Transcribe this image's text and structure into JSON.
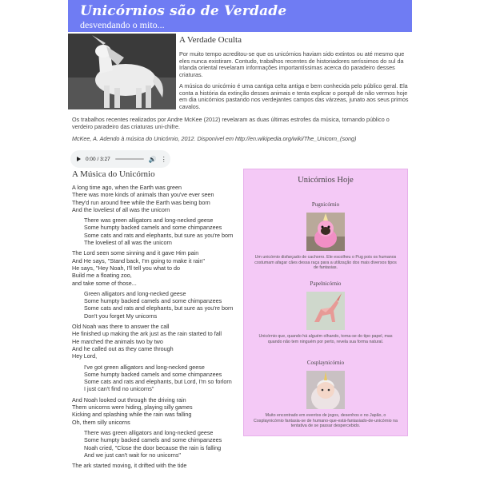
{
  "header": {
    "title": "Unicórnios são de Verdade",
    "subtitle": "desvendando o mito..."
  },
  "intro": {
    "heading": "A Verdade Oculta",
    "p1": "Por muito tempo acreditou-se que os unicórnios haviam sido extintos ou até mesmo que eles nunca existiram. Contudo, trabalhos recentes de historiadores seríssimos do sul da Irlanda oriental revelaram informações importantíssimas acerca do paradeiro desses criaturas.",
    "p2": "A música do unicórnio é uma cantiga celta antiga e bem conhecida pelo público geral. Ela conta a história da extinção desses animais e tenta explicar o porquê de não vermos hoje em dia unicórnios pastando nos verdejantes campos das várzeas, junato aos seus primos cavalos.",
    "p3": "Os trabalhos recentes realizados por Andre McKee (2012) revelaram as duas últimas estrofes da música, tornando público o verdeiro paradeiro das criaturas uni-chifre.",
    "reference": "McKee, A. Adendo à música do Unicórnio, 2012. Disponível em http://en.wikipedia.org/wiki/The_Unicorn_(song)"
  },
  "audio": {
    "time": "0:00 / 3:27"
  },
  "music": {
    "heading": "A Música do Unicórnio",
    "stanzas": [
      {
        "chorus": false,
        "lines": [
          "A long time ago, when the Earth was green",
          "There was more kinds of animals than you've ever seen",
          "They'd run around free while the Earth was being born",
          "And the loveliest of all was the unicorn"
        ]
      },
      {
        "chorus": true,
        "lines": [
          "There was green alligators and long-necked geese",
          "Some humpty backed camels and some chimpanzees",
          "Some cats and rats and elephants, but sure as you're born",
          "The loveliest of all was the unicorn"
        ]
      },
      {
        "chorus": false,
        "lines": [
          "The Lord seen some sinning and it gave Him pain",
          "And He says, \"Stand back, I'm going to make it rain\"",
          "He says, \"Hey Noah, I'll tell you what to do",
          "Build me a floating zoo,",
          "and take some of those..."
        ]
      },
      {
        "chorus": true,
        "lines": [
          "Green alligators and long-necked geese",
          "Some humpty backed camels and some chimpanzees",
          "Some cats and rats and elephants, but sure as you're born",
          "Don't you forget My unicorns"
        ]
      },
      {
        "chorus": false,
        "lines": [
          "Old Noah was there to answer the call",
          "He finished up making the ark just as the rain started to fall",
          "He marched the animals two by two",
          "And he called out as they came through",
          "Hey Lord,"
        ]
      },
      {
        "chorus": true,
        "lines": [
          "I've got green alligators and long-necked geese",
          "Some humpty backed camels and some chimpanzees",
          "Some cats and rats and elephants, but Lord, I'm so forlorn",
          "I just can't find no unicorns\""
        ]
      },
      {
        "chorus": false,
        "lines": [
          "And Noah looked out through the driving rain",
          "Them unicorns were hiding, playing silly games",
          "Kicking and splashing while the rain was falling",
          "Oh, them silly unicorns"
        ]
      },
      {
        "chorus": true,
        "lines": [
          "There was green alligators and long-necked geese",
          "Some humpty backed camels and some chimpanzees",
          "Noah cried, \"Close the door because the rain is falling",
          "And we just can't wait for no unicorns\""
        ]
      },
      {
        "chorus": false,
        "lines": [
          "The ark started moving, it drifted with the tide"
        ]
      }
    ]
  },
  "sidebar": {
    "title": "Unicórnios Hoje",
    "cards": [
      {
        "name": "Pugnicórnio",
        "description": "Um unicórnio disfarçado de cachorro. Ele escolheu o Pug pois os humanos costumam afagar cães dessa raça para a utilização dos mais diversos tipos de fantasias."
      },
      {
        "name": "Papelnicórnio",
        "description": "Unicórnio que, quando há alguém olhando, torna-se do tipo papel, mas quando não tem ninguém por perto, revela sua forma natural."
      },
      {
        "name": "Cosplaynicórnio",
        "description": "Muito encontrado em eventos de jogos, desenhos e no Japão, o Cosplaynicórnio fantasia-se de humano-que-está-fantasiado-de-unicórnio na tentativa de se passar despercebido."
      }
    ]
  },
  "colors": {
    "header_bg": "#6f7cf3",
    "sidebar_bg": "#f4c9f6"
  }
}
